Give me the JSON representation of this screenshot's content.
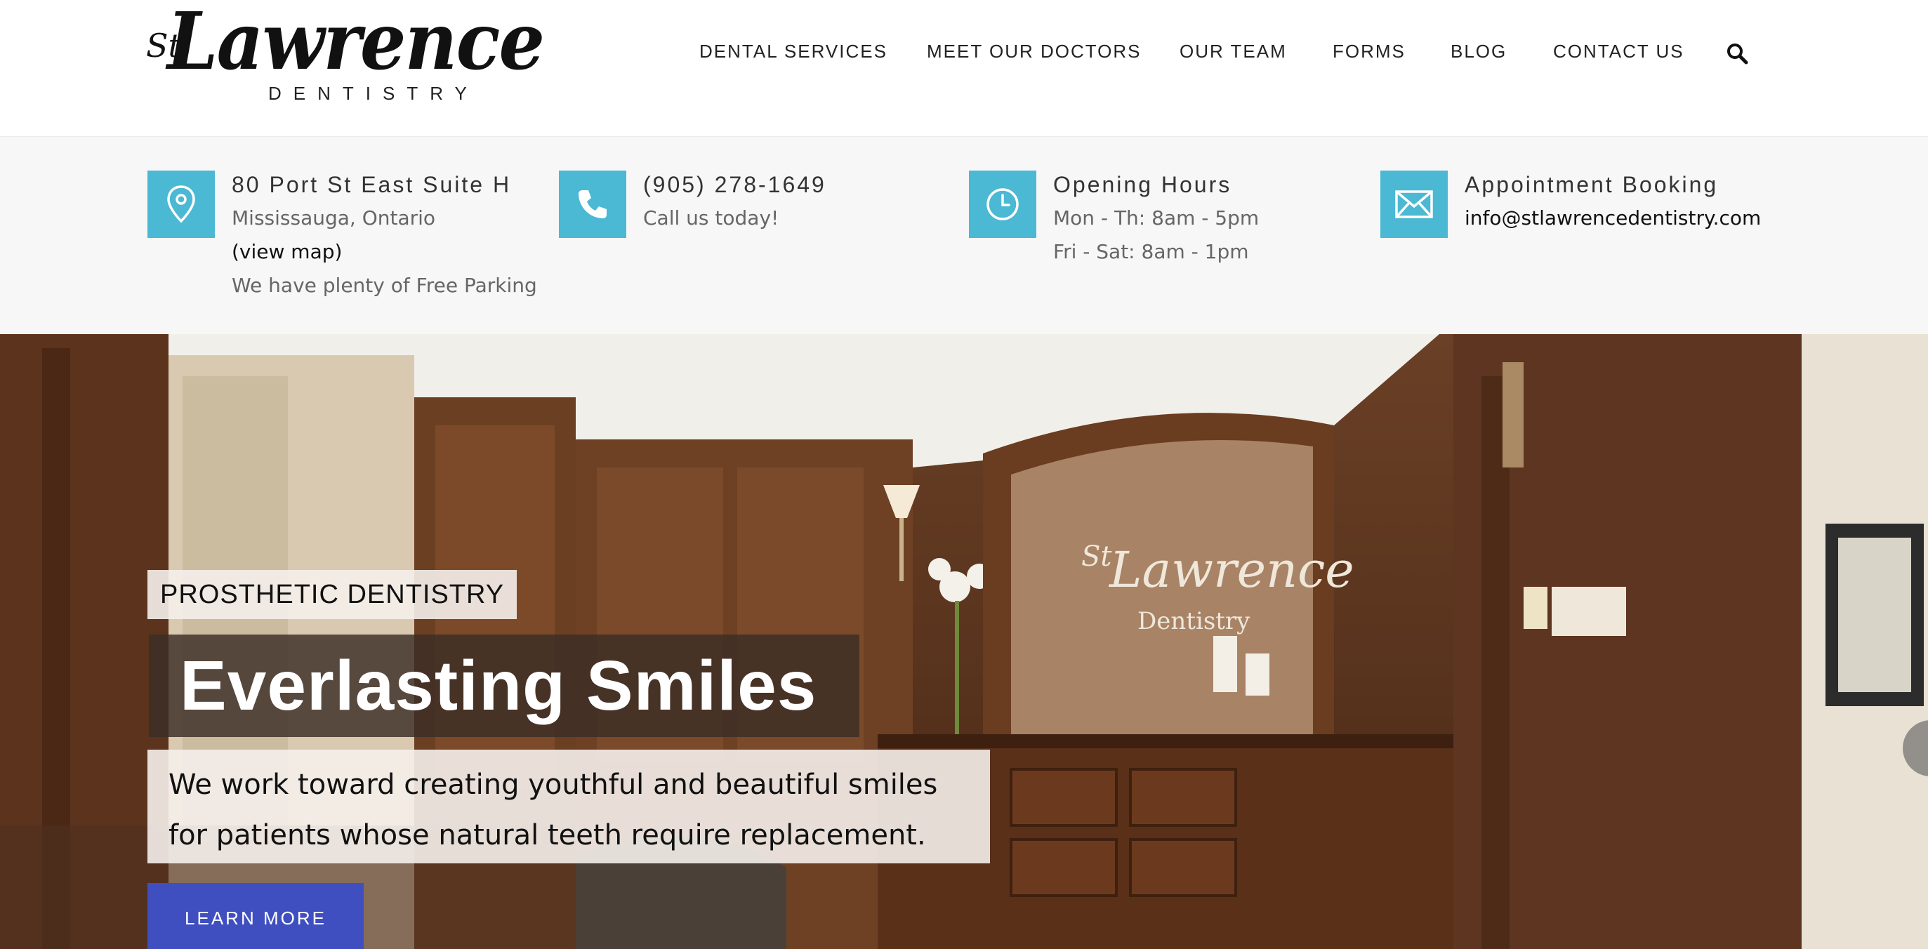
{
  "logo": {
    "st": "St",
    "name": "Lawrence",
    "sub": "DENTISTRY"
  },
  "nav": {
    "items": [
      {
        "label": "DENTAL SERVICES"
      },
      {
        "label": "MEET OUR DOCTORS"
      },
      {
        "label": "OUR TEAM"
      },
      {
        "label": "FORMS"
      },
      {
        "label": "BLOG"
      },
      {
        "label": "CONTACT US"
      }
    ],
    "search_icon": "search-icon"
  },
  "info": {
    "address": {
      "icon": "map-pin-icon",
      "title": "80 Port St East Suite H",
      "line1": "Mississauga, Ontario",
      "link": "(view map)",
      "line2": "We have plenty of Free Parking"
    },
    "phone": {
      "icon": "phone-icon",
      "title": "(905) 278-1649",
      "line1": "Call us today!"
    },
    "hours": {
      "icon": "clock-icon",
      "title": "Opening Hours",
      "line1": "Mon - Th: 8am - 5pm",
      "line2": "Fri - Sat: 8am - 1pm"
    },
    "booking": {
      "icon": "envelope-icon",
      "title": "Appointment Booking",
      "email": "info@stlawrencedentistry.com"
    }
  },
  "hero": {
    "tag": "PROSTHETIC DENTISTRY",
    "headline": "Everlasting Smiles",
    "subtext": "We work toward creating youthful and beautiful smiles for patients whose natural teeth require replacement.",
    "cta": "LEARN MORE",
    "wall_sign_st": "St",
    "wall_sign_name": "Lawrence",
    "wall_sign_sub": "Dentistry"
  },
  "colors": {
    "accent": "#4bb8d4",
    "cta": "#3f4fc0",
    "infobar_bg": "#f7f7f7"
  }
}
